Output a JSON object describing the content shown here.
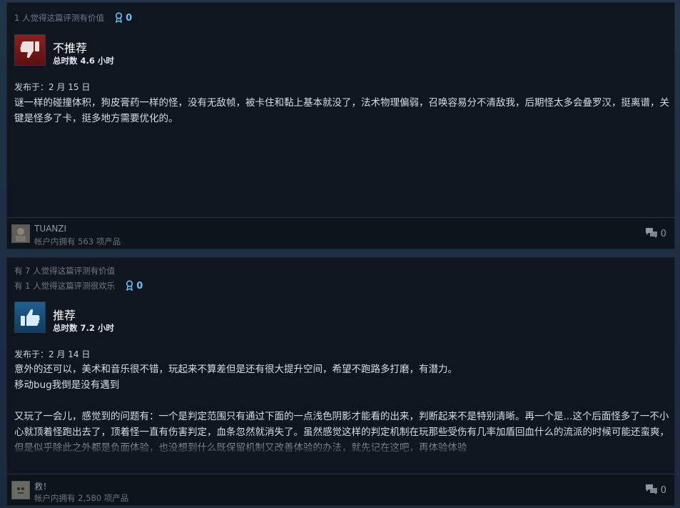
{
  "reviews": [
    {
      "helpful_lines": [
        "1 人觉得这篇评测有价值"
      ],
      "awards": "0",
      "verdict": "不推荐",
      "recommended": false,
      "hours": "总时数 4.6 小时",
      "posted": "发布于：2 月 15 日",
      "paragraphs": [
        "谜一样的碰撞体积，狗皮膏药一样的怪，没有无敌帧，被卡住和黏上基本就没了，法术物理偏弱，召唤容易分不清敌我，后期怪太多会叠罗汉，挺离谱，关键是怪多了卡，挺多地方需要优化的。"
      ],
      "author": "TUANZI",
      "products": "帐户内拥有 563 项产品",
      "comments": "0"
    },
    {
      "helpful_lines": [
        "有 7 人觉得这篇评测有价值",
        "有 1 人觉得这篇评测很欢乐"
      ],
      "awards": "0",
      "verdict": "推荐",
      "recommended": true,
      "hours": "总时数 7.2 小时",
      "posted": "发布于：2 月 14 日",
      "paragraphs": [
        "意外的还可以，美术和音乐很不错，玩起来不算差但是还有很大提升空间，希望不跑路多打磨，有潜力。",
        "移动bug我倒是没有遇到",
        "",
        "又玩了一会儿，感觉到的问题有：一个是判定范围只有通过下面的一点浅色阴影才能看的出来，判断起来不是特别清晰。再一个是...这个后面怪多了一不小心就顶着怪跑出去了，顶着怪一直有伤害判定，血条忽然就消失了。虽然感觉这样的判定机制在玩那些受伤有几率加盾回血什么的流派的时候可能还蛮爽，但是似乎除此之外都是负面体验，也没想到什么既保留机制又改善体验的办法，就先记在这吧，再体验体验"
      ],
      "author": "救！",
      "products": "帐户内拥有 2,580 项产品",
      "comments": "0"
    }
  ],
  "colors": {
    "background": "#1b2838",
    "card": "#0f1620",
    "award": "#66c0f4",
    "thumbs_down": "#8e1f1f",
    "thumbs_up": "#1f5f8f"
  },
  "icons": {
    "award": "award-ribbon-icon",
    "thumbs_down": "thumbs-down-icon",
    "thumbs_up": "thumbs-up-icon",
    "comments": "comment-bubbles-icon"
  }
}
